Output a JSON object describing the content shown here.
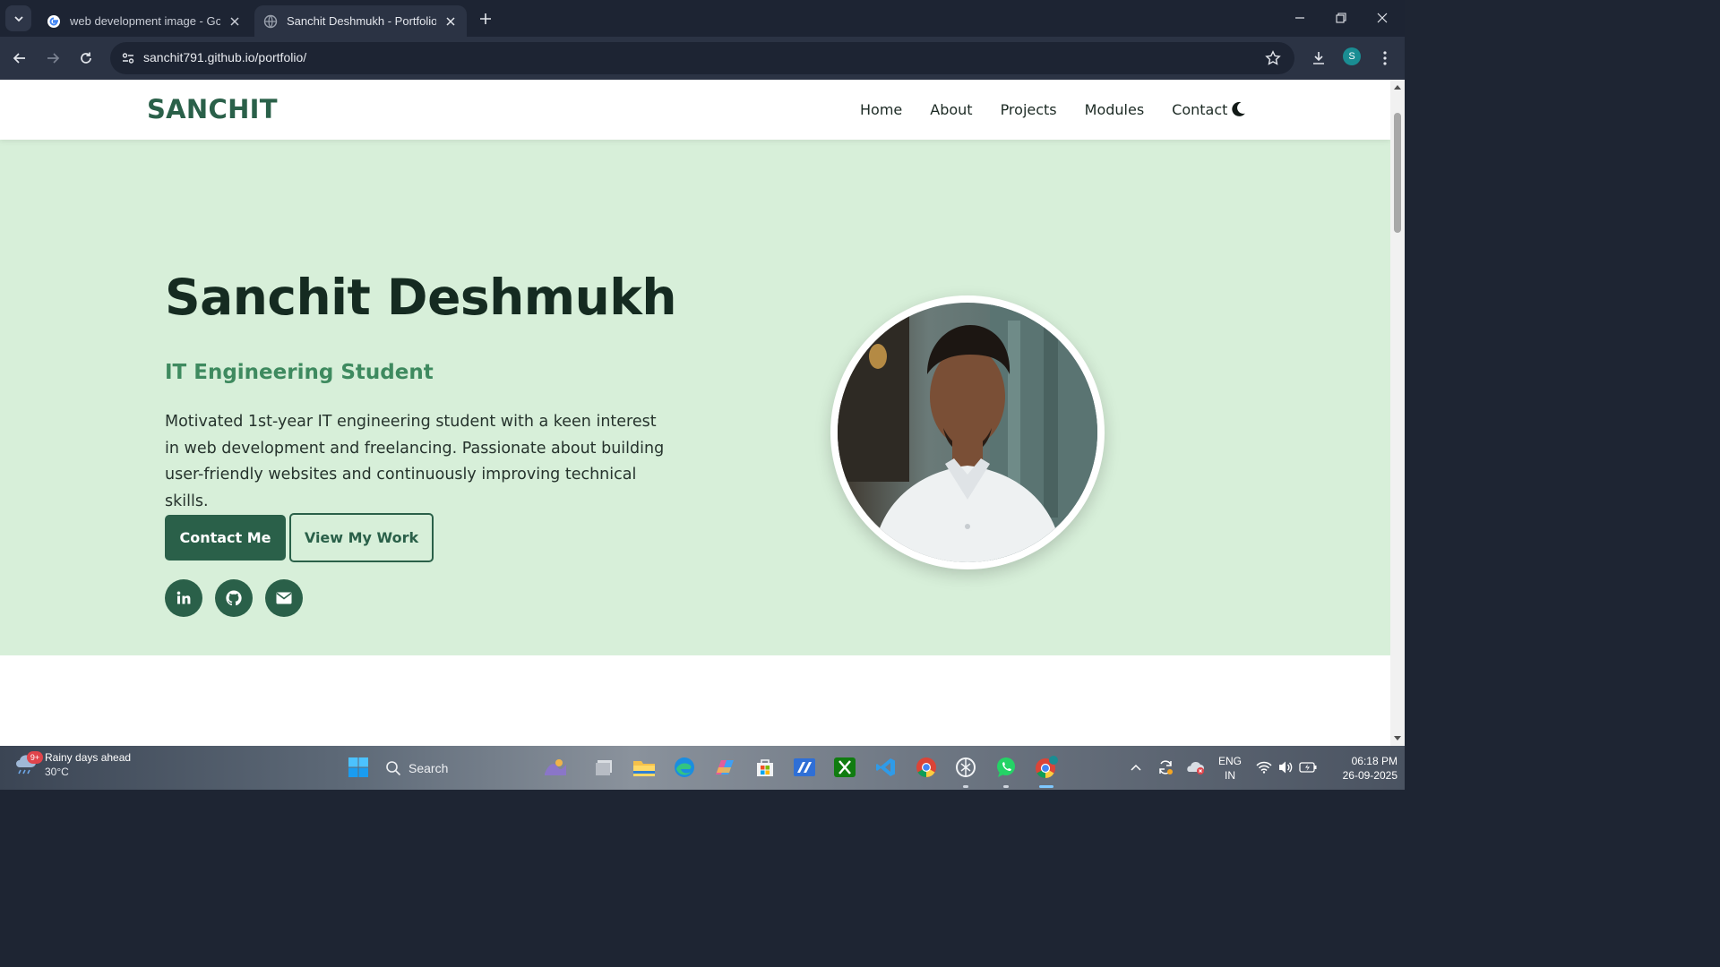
{
  "browser": {
    "tabs": [
      {
        "title": "web development image - Google Search",
        "active": false
      },
      {
        "title": "Sanchit Deshmukh - Portfolio",
        "active": true
      }
    ],
    "url": "sanchit791.github.io/portfolio/",
    "profile_initial": "S"
  },
  "site": {
    "logo": "SANCHIT",
    "nav": [
      "Home",
      "About",
      "Projects",
      "Modules",
      "Contact"
    ],
    "hero": {
      "name": "Sanchit Deshmukh",
      "role": "IT Engineering Student",
      "description": "Motivated 1st-year IT engineering student with a keen interest in web development and freelancing. Passionate about building user-friendly websites and continuously improving technical skills.",
      "primary_button": "Contact Me",
      "secondary_button": "View My Work",
      "social_icons": [
        "linkedin-icon",
        "github-icon",
        "email-icon"
      ]
    },
    "colors": {
      "accent": "#2a6049",
      "hero_bg": "#d7efd9",
      "role_text": "#3e8a5f"
    }
  },
  "taskbar": {
    "weather": {
      "title": "Rainy days ahead",
      "temp": "30°C",
      "badge": "9+"
    },
    "search_placeholder": "Search",
    "language": {
      "line1": "ENG",
      "line2": "IN"
    },
    "time": "06:18 PM",
    "date": "26-09-2025"
  }
}
